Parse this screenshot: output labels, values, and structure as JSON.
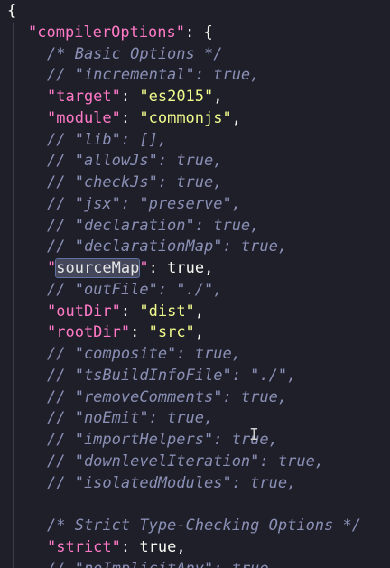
{
  "editor": {
    "lines": [
      {
        "indent": 0,
        "tokens": [
          {
            "t": "punc",
            "v": "{"
          }
        ]
      },
      {
        "indent": 1,
        "tokens": [
          {
            "t": "key",
            "v": "\"compilerOptions\""
          },
          {
            "t": "punc",
            "v": ": {"
          }
        ]
      },
      {
        "indent": 2,
        "tokens": [
          {
            "t": "cmt",
            "v": "/* Basic Options */"
          }
        ]
      },
      {
        "indent": 2,
        "tokens": [
          {
            "t": "cmt",
            "v": "// \"incremental\": true,"
          }
        ]
      },
      {
        "indent": 2,
        "tokens": [
          {
            "t": "key",
            "v": "\"target\""
          },
          {
            "t": "punc",
            "v": ": "
          },
          {
            "t": "str",
            "v": "\"es2015\""
          },
          {
            "t": "punc",
            "v": ","
          }
        ]
      },
      {
        "indent": 2,
        "tokens": [
          {
            "t": "key",
            "v": "\"module\""
          },
          {
            "t": "punc",
            "v": ": "
          },
          {
            "t": "str",
            "v": "\"commonjs\""
          },
          {
            "t": "punc",
            "v": ","
          }
        ]
      },
      {
        "indent": 2,
        "tokens": [
          {
            "t": "cmt",
            "v": "// \"lib\": [],"
          }
        ]
      },
      {
        "indent": 2,
        "tokens": [
          {
            "t": "cmt",
            "v": "// \"allowJs\": true,"
          }
        ]
      },
      {
        "indent": 2,
        "tokens": [
          {
            "t": "cmt",
            "v": "// \"checkJs\": true,"
          }
        ]
      },
      {
        "indent": 2,
        "tokens": [
          {
            "t": "cmt",
            "v": "// \"jsx\": \"preserve\","
          }
        ]
      },
      {
        "indent": 2,
        "tokens": [
          {
            "t": "cmt",
            "v": "// \"declaration\": true,"
          }
        ]
      },
      {
        "indent": 2,
        "tokens": [
          {
            "t": "cmt",
            "v": "// \"declarationMap\": true,"
          }
        ]
      },
      {
        "indent": 2,
        "tokens": [
          {
            "t": "key",
            "v": "\""
          },
          {
            "t": "sel",
            "v": "sourceMap"
          },
          {
            "t": "key",
            "v": "\""
          },
          {
            "t": "punc",
            "v": ": "
          },
          {
            "t": "bool",
            "v": "true"
          },
          {
            "t": "punc",
            "v": ","
          }
        ]
      },
      {
        "indent": 2,
        "tokens": [
          {
            "t": "cmt",
            "v": "// \"outFile\": \"./\","
          }
        ]
      },
      {
        "indent": 2,
        "tokens": [
          {
            "t": "key",
            "v": "\"outDir\""
          },
          {
            "t": "punc",
            "v": ": "
          },
          {
            "t": "str",
            "v": "\"dist\""
          },
          {
            "t": "punc",
            "v": ","
          }
        ]
      },
      {
        "indent": 2,
        "tokens": [
          {
            "t": "key",
            "v": "\"rootDir\""
          },
          {
            "t": "punc",
            "v": ": "
          },
          {
            "t": "str",
            "v": "\"src\""
          },
          {
            "t": "punc",
            "v": ","
          }
        ]
      },
      {
        "indent": 2,
        "tokens": [
          {
            "t": "cmt",
            "v": "// \"composite\": true,"
          }
        ]
      },
      {
        "indent": 2,
        "tokens": [
          {
            "t": "cmt",
            "v": "// \"tsBuildInfoFile\": \"./\","
          }
        ]
      },
      {
        "indent": 2,
        "tokens": [
          {
            "t": "cmt",
            "v": "// \"removeComments\": true,"
          }
        ]
      },
      {
        "indent": 2,
        "tokens": [
          {
            "t": "cmt",
            "v": "// \"noEmit\": true,"
          }
        ]
      },
      {
        "indent": 2,
        "tokens": [
          {
            "t": "cmt",
            "v": "// \"importHelpers\": true,"
          }
        ]
      },
      {
        "indent": 2,
        "tokens": [
          {
            "t": "cmt",
            "v": "// \"downlevelIteration\": true,"
          }
        ]
      },
      {
        "indent": 2,
        "tokens": [
          {
            "t": "cmt",
            "v": "// \"isolatedModules\": true,"
          }
        ]
      },
      {
        "indent": 2,
        "tokens": []
      },
      {
        "indent": 2,
        "tokens": [
          {
            "t": "cmt",
            "v": "/* Strict Type-Checking Options */"
          }
        ]
      },
      {
        "indent": 2,
        "tokens": [
          {
            "t": "key",
            "v": "\"strict\""
          },
          {
            "t": "punc",
            "v": ": "
          },
          {
            "t": "bool",
            "v": "true"
          },
          {
            "t": "punc",
            "v": ","
          }
        ]
      },
      {
        "indent": 2,
        "tokens": [
          {
            "t": "cmt",
            "v": "// \"noImplicitAny\": true,"
          }
        ]
      }
    ],
    "cursor_icon": "text-cursor-icon",
    "cursor_glyph": "I"
  },
  "colors": {
    "background": "#1e1f29",
    "key": "#ff79c6",
    "string": "#f1fa8c",
    "comment": "#8a8fb5",
    "plain": "#f8f8f2",
    "selection": "#44475a"
  }
}
